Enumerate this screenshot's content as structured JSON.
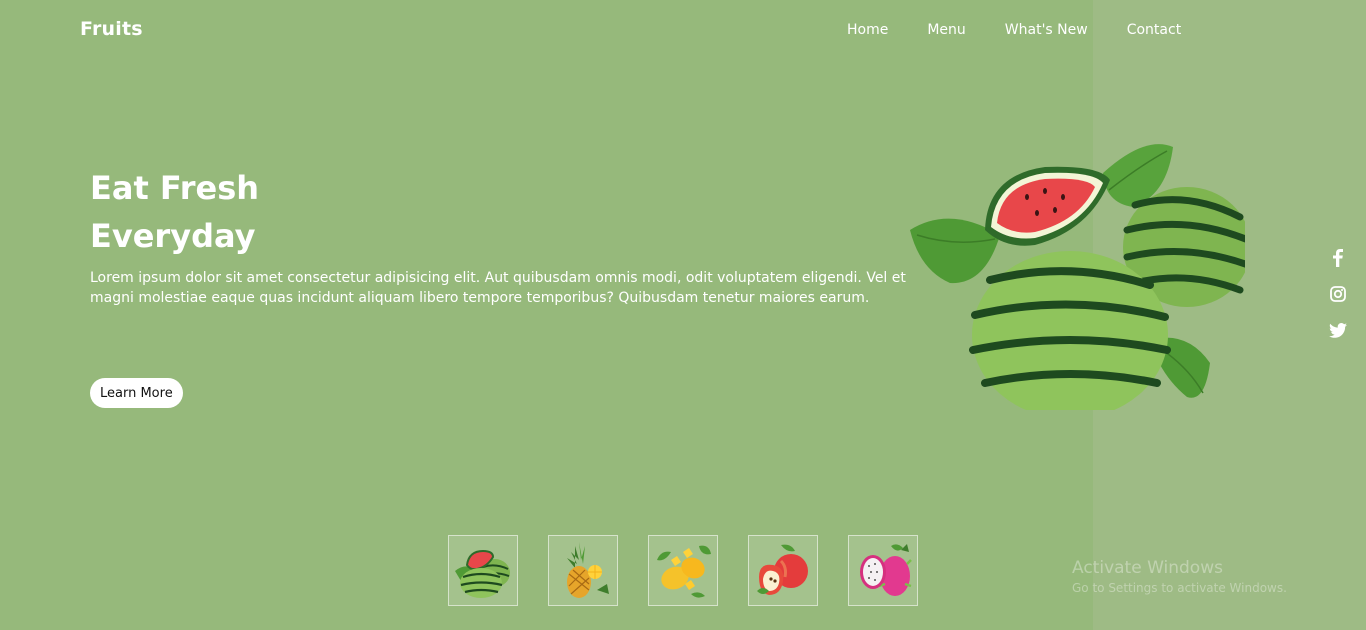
{
  "header": {
    "logo": "Fruits",
    "nav": [
      "Home",
      "Menu",
      "What's New",
      "Contact"
    ]
  },
  "hero": {
    "title_line1": "Eat Fresh",
    "title_line2": "Everyday",
    "description": "Lorem ipsum dolor sit amet consectetur adipisicing elit. Aut quibusdam omnis modi, odit voluptatem eligendi. Vel et magni molestiae eaque quas incidunt aliquam libero tempore temporibus? Quibusdam tenetur maiores earum.",
    "cta_label": "Learn More",
    "image": "watermelon-image"
  },
  "social": [
    "facebook-icon",
    "instagram-icon",
    "twitter-icon"
  ],
  "thumbnails": [
    "watermelon-thumb",
    "pineapple-thumb",
    "mango-thumb",
    "apple-thumb",
    "dragonfruit-thumb"
  ],
  "watermark": {
    "title": "Activate Windows",
    "subtitle": "Go to Settings to activate Windows."
  },
  "colors": {
    "background": "#96b97b",
    "panel": "#9ebb85",
    "text": "#ffffff",
    "button_bg": "#ffffff"
  }
}
